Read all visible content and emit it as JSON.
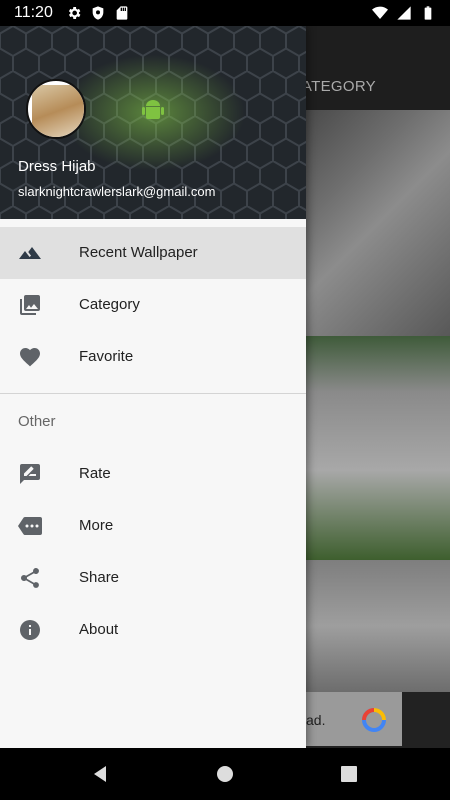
{
  "status_bar": {
    "time": "11:20",
    "icons_left": [
      "settings-icon",
      "shield-icon",
      "sd-card-icon"
    ],
    "icons_right": [
      "wifi-icon",
      "signal-icon",
      "battery-icon"
    ]
  },
  "app": {
    "toolbar_text": "CATEGORY",
    "ad_text": "ad."
  },
  "drawer": {
    "header": {
      "title": "Dress Hijab",
      "email": "slarknightcrawlerslark@gmail.com"
    },
    "menu": [
      {
        "label": "Recent Wallpaper",
        "icon": "landscape-icon",
        "active": true
      },
      {
        "label": "Category",
        "icon": "photo-library-icon",
        "active": false
      },
      {
        "label": "Favorite",
        "icon": "heart-icon",
        "active": false
      }
    ],
    "section_title": "Other",
    "other_menu": [
      {
        "label": "Rate",
        "icon": "rate-review-icon"
      },
      {
        "label": "More",
        "icon": "more-tag-icon"
      },
      {
        "label": "Share",
        "icon": "share-icon"
      },
      {
        "label": "About",
        "icon": "info-icon"
      }
    ]
  },
  "colors": {
    "accent_green": "#7fc241",
    "drawer_bg": "#f7f7f7",
    "active_bg": "#e0e0e0",
    "icon_color": "#5f6368"
  },
  "nav_bar": {
    "buttons": [
      "back-icon",
      "home-icon",
      "recents-icon"
    ]
  }
}
